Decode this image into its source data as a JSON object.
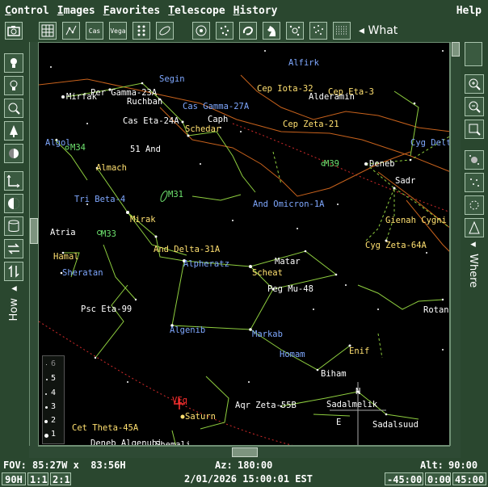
{
  "menubar": {
    "items": [
      {
        "first": "C",
        "rest": "ontrol"
      },
      {
        "first": "I",
        "rest": "mages"
      },
      {
        "first": "F",
        "rest": "avorites"
      },
      {
        "first": "T",
        "rest": "elescope"
      },
      {
        "first": "H",
        "rest": "istory"
      }
    ],
    "help": "Help"
  },
  "toolbar": {
    "cas_label": "Cas",
    "vega_label": "Vega",
    "what_label": "What"
  },
  "sidepanels": {
    "how_label": "How",
    "where_label": "Where"
  },
  "legend": {
    "mags": [
      "6",
      "5",
      "4",
      "3",
      "2",
      "1"
    ]
  },
  "sky": {
    "labels": [
      {
        "t": "Alfirk",
        "c": "blue"
      },
      {
        "t": "Segin",
        "c": "blue"
      },
      {
        "t": "Mirfak",
        "c": "white"
      },
      {
        "t": "Per Gamma-23A",
        "c": "white"
      },
      {
        "t": "Ruchbah",
        "c": "white"
      },
      {
        "t": "Cas Gamma-27A",
        "c": "blue"
      },
      {
        "t": "Cep Iota-32",
        "c": "yellow"
      },
      {
        "t": "Alderamin",
        "c": "white"
      },
      {
        "t": "Cep Eta-3",
        "c": "yellow"
      },
      {
        "t": "Cas Eta-24A",
        "c": "white"
      },
      {
        "t": "Caph",
        "c": "white"
      },
      {
        "t": "Schedar",
        "c": "yellow"
      },
      {
        "t": "Cep Zeta-21",
        "c": "yellow"
      },
      {
        "t": "Algol",
        "c": "blue"
      },
      {
        "t": "M34",
        "c": "green"
      },
      {
        "t": "51 And",
        "c": "white"
      },
      {
        "t": "M39",
        "c": "green"
      },
      {
        "t": "Deneb",
        "c": "white"
      },
      {
        "t": "Cyg Delt",
        "c": "blue"
      },
      {
        "t": "Almach",
        "c": "yellow"
      },
      {
        "t": "Sadr",
        "c": "white"
      },
      {
        "t": "Tri Beta-4",
        "c": "blue"
      },
      {
        "t": "M31",
        "c": "green"
      },
      {
        "t": "And Omicron-1A",
        "c": "blue"
      },
      {
        "t": "Mirak",
        "c": "yellow"
      },
      {
        "t": "Gienah Cygni",
        "c": "yellow"
      },
      {
        "t": "Atria",
        "c": "white"
      },
      {
        "t": "M33",
        "c": "green"
      },
      {
        "t": "Cyg Zeta-64A",
        "c": "yellow"
      },
      {
        "t": "Hamal",
        "c": "yellow"
      },
      {
        "t": "And Delta-31A",
        "c": "yellow"
      },
      {
        "t": "Matar",
        "c": "white"
      },
      {
        "t": "Alpheratz",
        "c": "blue"
      },
      {
        "t": "Scheat",
        "c": "yellow"
      },
      {
        "t": "Sheratan",
        "c": "blue"
      },
      {
        "t": "Peg Mu-48",
        "c": "white"
      },
      {
        "t": "Psc Eta-99",
        "c": "white"
      },
      {
        "t": "Rotane",
        "c": "white"
      },
      {
        "t": "Algenib",
        "c": "blue"
      },
      {
        "t": "Markab",
        "c": "blue"
      },
      {
        "t": "Homam",
        "c": "blue"
      },
      {
        "t": "Enif",
        "c": "yellow"
      },
      {
        "t": "Biham",
        "c": "white"
      },
      {
        "t": "N",
        "c": "white"
      },
      {
        "t": "VEq",
        "c": "red"
      },
      {
        "t": "Aqr Zeta-55B",
        "c": "white"
      },
      {
        "t": "Sadalmelik",
        "c": "white"
      },
      {
        "t": "Saturn",
        "c": "yellow"
      },
      {
        "t": "E",
        "c": "white"
      },
      {
        "t": "Sadalsuud",
        "c": "white"
      },
      {
        "t": "Cet Theta-45A",
        "c": "yellow"
      },
      {
        "t": "Deneb Algenubi",
        "c": "white"
      },
      {
        "t": "Shemali",
        "c": "white"
      }
    ]
  },
  "status": {
    "fov_label": "FOV:",
    "fov_value": "85:27W x  83:56H",
    "az_label": "Az:",
    "az_value": "180:00",
    "alt_label": "Alt:",
    "alt_value": "90:00",
    "datetime": "2/01/2026 15:00:01 EST",
    "btn_90h": "90H",
    "btn_1to1": "1:1",
    "btn_2to1": "2:1",
    "btn_m45": "-45:00",
    "btn_0": "0:00",
    "btn_45": "45:00"
  },
  "colors": {
    "panel": "#2a472f",
    "sky": "#000000",
    "constellation_line": "#8fcf3f",
    "boundary": "#c8621c",
    "ecliptic": "#d12a2a",
    "label_blue": "#7fa8ff",
    "label_yellow": "#ffe070",
    "label_white": "#ffffff",
    "label_green": "#6fe36f"
  }
}
